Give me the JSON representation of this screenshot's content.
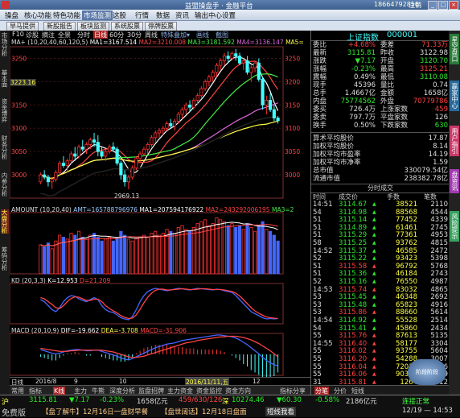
{
  "window": {
    "title": "益盟操盘手 · 金融平台",
    "account": "18664792856",
    "logout": "注销"
  },
  "menu": [
    "操盘",
    "核心功能",
    "特色功能",
    "市场监测",
    "这股",
    "行情",
    "数据",
    "资讯",
    "输出中心",
    "设置"
  ],
  "toolbar": [
    "早马提供",
    "新股报告",
    "板块监测",
    "系统股票",
    "停牌股票"
  ],
  "left_tabs": [
    "市场分析",
    "基本面",
    "资金博弈",
    "财务分析",
    "内参分析",
    "大盘分析",
    "筹码分析"
  ],
  "chart_toolbar": {
    "items": [
      "F10",
      "诊股",
      "摘注",
      "全景",
      "分时",
      "日线",
      "60分",
      "30分",
      "周线"
    ],
    "active": "日线"
  },
  "ma_legend": {
    "label": "MA+ (10,20,40,60,120,5)",
    "ma1": "MA1=3167.514",
    "ma2": "MA2=3210.008",
    "ma3": "MA3=3181.592",
    "ma4": "MA4=3136.147",
    "ma5": "MA5="
  },
  "price_axis": [
    "3250",
    "3200",
    "3150",
    "3100",
    "3050",
    "3000"
  ],
  "price_marker": "3223.16",
  "low_marker": "2969.13",
  "amount_legend": {
    "label": "AMOUNT (10,20,40)",
    "amt": "AMT=165788796976",
    "ma1": "MA1=207594176922",
    "ma2": "MA2=243292006195",
    "ma3": "MA3=2"
  },
  "kd_legend": {
    "label": "KD (20,3,3)",
    "k": "K=12.953",
    "d": "D=21.209"
  },
  "macd_legend": {
    "label": "MACD (20,10,9)",
    "dif": "DIF=-19.662",
    "dea": "DEA=-3.708",
    "macd": "MACD=-31.906"
  },
  "date_axis": {
    "left": "日线",
    "d1": "2016/8",
    "d2": "9",
    "d3": "10",
    "d4": "2016/11/11,五",
    "d5": "12"
  },
  "bottom_tabs": [
    "常用",
    "指标",
    "K线",
    "主力",
    "牛熊",
    "深度分析",
    "监盘招牌",
    "主力资金",
    "资金监控",
    "资金方向",
    "指标分享"
  ],
  "quote": {
    "name": "上证指数",
    "code": "000001",
    "rows": [
      {
        "l1": "委比",
        "v1": "+4.68%",
        "l2": "委差",
        "v2": "71.33万",
        "c1": "red",
        "c2": "red"
      },
      {
        "l1": "最新",
        "v1": "3115.81",
        "l2": "昨收",
        "v2": "3122.98",
        "c1": "grn",
        "c2": "wht"
      },
      {
        "l1": "涨跌",
        "v1": "▼7.17",
        "l2": "开盘",
        "v2": "3120.70",
        "c1": "grn",
        "c2": "grn"
      },
      {
        "l1": "涨幅",
        "v1": "-0.23%",
        "l2": "最高",
        "v2": "3125.21",
        "c1": "grn",
        "c2": "red"
      },
      {
        "l1": "震幅",
        "v1": "0.49%",
        "l2": "最低",
        "v2": "3110.08",
        "c1": "wht",
        "c2": "grn"
      },
      {
        "l1": "现手",
        "v1": "45396",
        "l2": "量比",
        "v2": "0.74",
        "c1": "wht",
        "c2": "wht"
      },
      {
        "l1": "总手",
        "v1": "1.4667亿",
        "l2": "金额",
        "v2": "1658亿",
        "c1": "wht",
        "c2": "wht"
      },
      {
        "l1": "内盘",
        "v1": "75774562",
        "l2": "外盘",
        "v2": "70779786",
        "c1": "grn",
        "c2": "red"
      },
      {
        "l1": "委买",
        "v1": "726.4万",
        "l2": "上涨家数",
        "v2": "459",
        "c1": "wht",
        "c2": "red"
      },
      {
        "l1": "委卖",
        "v1": "797.7万",
        "l2": "平盘家数",
        "v2": "126",
        "c1": "wht",
        "c2": "wht"
      },
      {
        "l1": "换手",
        "v1": "0.50%",
        "l2": "下跌家数",
        "v2": "630",
        "c1": "wht",
        "c2": "grn"
      }
    ],
    "fin": [
      {
        "l": "算术平均股价",
        "v": "17.87"
      },
      {
        "l": "加权平均股价",
        "v": "8.14"
      },
      {
        "l": "加权平均市盈率",
        "v": "14.19"
      },
      {
        "l": "加权平均市净率",
        "v": "1.59"
      },
      {
        "l": "总市值",
        "v": "330079.54亿"
      },
      {
        "l": "流通市值",
        "v": "238382.78亿"
      }
    ],
    "ticks_title": "分时成交",
    "tick_headers": [
      "时间",
      "成交价",
      "手数",
      "笔数"
    ],
    "ticks": [
      {
        "t": "14:51",
        "p": "3114.67",
        "v": "38521",
        "n": "2110"
      },
      {
        "t": "54",
        "p": "3114.98",
        "v": "88568",
        "n": "4544"
      },
      {
        "t": "51",
        "p": "3115.14",
        "v": "77452",
        "n": "4339"
      },
      {
        "t": "51",
        "p": "3114.89",
        "v": "61461",
        "n": "2745"
      },
      {
        "t": "51",
        "p": "3115.29",
        "v": "77361",
        "n": "4953"
      },
      {
        "t": "58",
        "p": "3115.25",
        "v": "93762",
        "n": "4815"
      },
      {
        "t": "14:52",
        "p": "3115.37",
        "v": "46585",
        "n": "2472"
      },
      {
        "t": "52",
        "p": "3115.22",
        "v": "93423",
        "n": "5398"
      },
      {
        "t": "51",
        "p": "3115.58",
        "v": "96792",
        "n": "5768"
      },
      {
        "t": "51",
        "p": "3115.36",
        "v": "46184",
        "n": "2743"
      },
      {
        "t": "52",
        "p": "3115.16",
        "v": "76550",
        "n": "4987"
      },
      {
        "t": "14:53",
        "p": "3115.74",
        "v": "83032",
        "n": "4865"
      },
      {
        "t": "53",
        "p": "3115.45",
        "v": "46348",
        "n": "2692"
      },
      {
        "t": "53",
        "p": "3115.48",
        "v": "65823",
        "n": "4916"
      },
      {
        "t": "53",
        "p": "3115.86",
        "v": "88660",
        "n": "5614"
      },
      {
        "t": "14:54",
        "p": "3114.92",
        "v": "55528",
        "n": "2514"
      },
      {
        "t": "54",
        "p": "3115.41",
        "v": "45860",
        "n": "2434"
      },
      {
        "t": "55",
        "p": "3115.76",
        "v": "87613",
        "n": "5135"
      },
      {
        "t": "14:55",
        "p": "3116.40",
        "v": "58177",
        "n": "3304"
      },
      {
        "t": "55",
        "p": "3116.02",
        "v": "93755",
        "n": "5604"
      },
      {
        "t": "55",
        "p": "3116.20",
        "v": "54288",
        "n": "3007"
      },
      {
        "t": "55",
        "p": "3116.04",
        "v": "72016",
        "n": "4396"
      },
      {
        "t": "55",
        "p": "3116.06",
        "v": "90310",
        "n": "5409"
      },
      {
        "t": "31",
        "p": "3115.81",
        "v": "1264",
        "n": "2312"
      }
    ],
    "bottom_tabs": [
      "分笔",
      "分价",
      "短线"
    ]
  },
  "right_tabs": [
    "星空盘口",
    "赢家中心",
    "用户指引",
    "盘资讯",
    "风险提示"
  ],
  "status": {
    "index_name": "沪",
    "index_value": "3115.81",
    "index_change": "▼7.17",
    "index_pct": "-0.23%",
    "amount": "1658亿元",
    "up_down": "459/630/126",
    "sz_name": "深",
    "sz_value": "10274.46",
    "sz_change": "▼60.30",
    "sz_pct": "-0.58%",
    "sz_amount": "2186亿元",
    "connection": "连接正常",
    "news1": "【盘了解牛】12月16日一盘财早餐",
    "news2": "【盘世阔话】12月18日盘面",
    "news3": "短线我看",
    "ad": "阶段阶段",
    "free": "免费版",
    "clock": "12/19 — 14:53"
  },
  "candles": [
    [
      2985,
      3005,
      2980,
      3000
    ],
    [
      3000,
      3010,
      2990,
      2995
    ],
    [
      2995,
      3000,
      2975,
      2985
    ],
    [
      2985,
      2995,
      2970,
      2990
    ],
    [
      2990,
      3010,
      2985,
      3005
    ],
    [
      3005,
      3030,
      3000,
      3025
    ],
    [
      3025,
      3040,
      3015,
      3020
    ],
    [
      3020,
      3035,
      3005,
      3030
    ],
    [
      3030,
      3050,
      3025,
      3045
    ],
    [
      3045,
      3060,
      3030,
      3040
    ],
    [
      3040,
      3065,
      3035,
      3060
    ],
    [
      3060,
      3075,
      3050,
      3055
    ],
    [
      3055,
      3070,
      3045,
      3065
    ],
    [
      3065,
      3080,
      3055,
      3075
    ],
    [
      3075,
      3090,
      3060,
      3070
    ],
    [
      3070,
      3085,
      3040,
      3050
    ],
    [
      3050,
      3060,
      3035,
      3040
    ],
    [
      3040,
      3055,
      3030,
      3050
    ],
    [
      3050,
      3065,
      3045,
      3060
    ],
    [
      3060,
      3070,
      3050,
      3055
    ],
    [
      3055,
      3060,
      3020,
      3025
    ],
    [
      3025,
      3030,
      2990,
      3000
    ],
    [
      3000,
      3010,
      2975,
      2985
    ],
    [
      2985,
      3000,
      2969,
      2995
    ],
    [
      2995,
      3020,
      2990,
      3015
    ],
    [
      3015,
      3040,
      3010,
      3035
    ],
    [
      3035,
      3050,
      3025,
      3045
    ],
    [
      3045,
      3060,
      3040,
      3055
    ],
    [
      3055,
      3070,
      3045,
      3065
    ],
    [
      3065,
      3085,
      3060,
      3080
    ],
    [
      3080,
      3095,
      3070,
      3090
    ],
    [
      3090,
      3100,
      3080,
      3095
    ],
    [
      3095,
      3105,
      3085,
      3100
    ],
    [
      3100,
      3115,
      3095,
      3110
    ],
    [
      3110,
      3120,
      3100,
      3105
    ],
    [
      3105,
      3120,
      3095,
      3115
    ],
    [
      3115,
      3135,
      3110,
      3130
    ],
    [
      3130,
      3145,
      3120,
      3140
    ],
    [
      3140,
      3155,
      3130,
      3150
    ],
    [
      3150,
      3160,
      3135,
      3145
    ],
    [
      3145,
      3165,
      3140,
      3160
    ],
    [
      3160,
      3175,
      3150,
      3170
    ],
    [
      3170,
      3190,
      3165,
      3185
    ],
    [
      3185,
      3205,
      3180,
      3200
    ],
    [
      3200,
      3215,
      3190,
      3210
    ],
    [
      3210,
      3225,
      3200,
      3220
    ],
    [
      3220,
      3240,
      3210,
      3235
    ],
    [
      3235,
      3250,
      3225,
      3245
    ],
    [
      3245,
      3262,
      3235,
      3255
    ],
    [
      3255,
      3265,
      3240,
      3250
    ],
    [
      3250,
      3265,
      3245,
      3260
    ],
    [
      3260,
      3270,
      3245,
      3255
    ],
    [
      3255,
      3262,
      3235,
      3240
    ],
    [
      3240,
      3250,
      3225,
      3245
    ],
    [
      3245,
      3255,
      3215,
      3220
    ],
    [
      3220,
      3235,
      3200,
      3230
    ],
    [
      3230,
      3245,
      3220,
      3240
    ],
    [
      3240,
      3250,
      3200,
      3205
    ],
    [
      3205,
      3210,
      3140,
      3150
    ],
    [
      3150,
      3170,
      3130,
      3160
    ],
    [
      3160,
      3175,
      3135,
      3140
    ],
    [
      3140,
      3150,
      3115,
      3122
    ],
    [
      3122,
      3126,
      3110,
      3116
    ]
  ],
  "amount_vals": [
    1.5,
    1.4,
    1.6,
    1.3,
    1.7,
    2.0,
    1.9,
    1.8,
    2.1,
    2.0,
    2.2,
    1.9,
    1.8,
    2.0,
    2.1,
    1.9,
    1.7,
    1.8,
    1.9,
    1.7,
    1.9,
    2.2,
    2.0,
    1.8,
    1.7,
    1.8,
    1.9,
    2.0,
    1.9,
    2.1,
    2.2,
    2.0,
    2.1,
    2.3,
    2.2,
    2.1,
    2.4,
    2.5,
    2.3,
    2.2,
    2.4,
    2.6,
    2.7,
    2.8,
    2.5,
    2.6,
    2.9,
    2.8,
    2.7,
    2.5,
    2.6,
    2.4,
    2.5,
    2.3,
    2.6,
    2.4,
    2.2,
    2.5,
    2.7,
    2.3,
    2.2,
    2.0,
    1.7
  ],
  "kd_k": [
    60,
    55,
    45,
    35,
    30,
    40,
    55,
    65,
    70,
    68,
    62,
    58,
    55,
    60,
    65,
    60,
    45,
    35,
    30,
    28,
    22,
    15,
    12,
    10,
    18,
    35,
    55,
    70,
    80,
    85,
    88,
    86,
    84,
    82,
    84,
    86,
    88,
    87,
    85,
    84,
    86,
    88,
    87,
    86,
    85,
    84,
    86,
    85,
    82,
    80,
    78,
    70,
    60,
    50,
    40,
    30,
    25,
    20,
    15,
    12,
    13,
    12,
    13
  ],
  "kd_d": [
    65,
    62,
    55,
    48,
    40,
    38,
    45,
    55,
    63,
    67,
    66,
    62,
    58,
    58,
    61,
    61,
    55,
    45,
    38,
    32,
    27,
    20,
    16,
    13,
    14,
    22,
    36,
    52,
    66,
    76,
    83,
    86,
    86,
    84,
    84,
    85,
    86,
    87,
    86,
    85,
    85,
    86,
    87,
    87,
    86,
    85,
    85,
    85,
    84,
    82,
    80,
    76,
    69,
    60,
    50,
    40,
    32,
    26,
    21,
    17,
    15,
    14,
    13
  ],
  "macd_dif": [
    8,
    6,
    4,
    2,
    1,
    2,
    4,
    6,
    7,
    8,
    8,
    7,
    6,
    6,
    7,
    7,
    5,
    3,
    1,
    -1,
    -3,
    -6,
    -8,
    -9,
    -7,
    -4,
    -1,
    2,
    5,
    8,
    11,
    13,
    15,
    17,
    18,
    19,
    21,
    23,
    24,
    25,
    26,
    27,
    28,
    29,
    30,
    31,
    32,
    32,
    31,
    30,
    29,
    27,
    24,
    20,
    16,
    11,
    6,
    1,
    -5,
    -10,
    -14,
    -17,
    -19
  ],
  "macd_dea": [
    10,
    9,
    8,
    7,
    6,
    5,
    5,
    5,
    6,
    6,
    7,
    7,
    7,
    7,
    7,
    7,
    7,
    6,
    5,
    4,
    2,
    0,
    -2,
    -4,
    -5,
    -5,
    -4,
    -3,
    -1,
    1,
    3,
    5,
    7,
    9,
    11,
    13,
    15,
    17,
    19,
    20,
    21,
    23,
    24,
    25,
    26,
    27,
    28,
    29,
    29,
    30,
    30,
    30,
    29,
    28,
    26,
    24,
    21,
    18,
    14,
    10,
    6,
    1,
    -4
  ]
}
